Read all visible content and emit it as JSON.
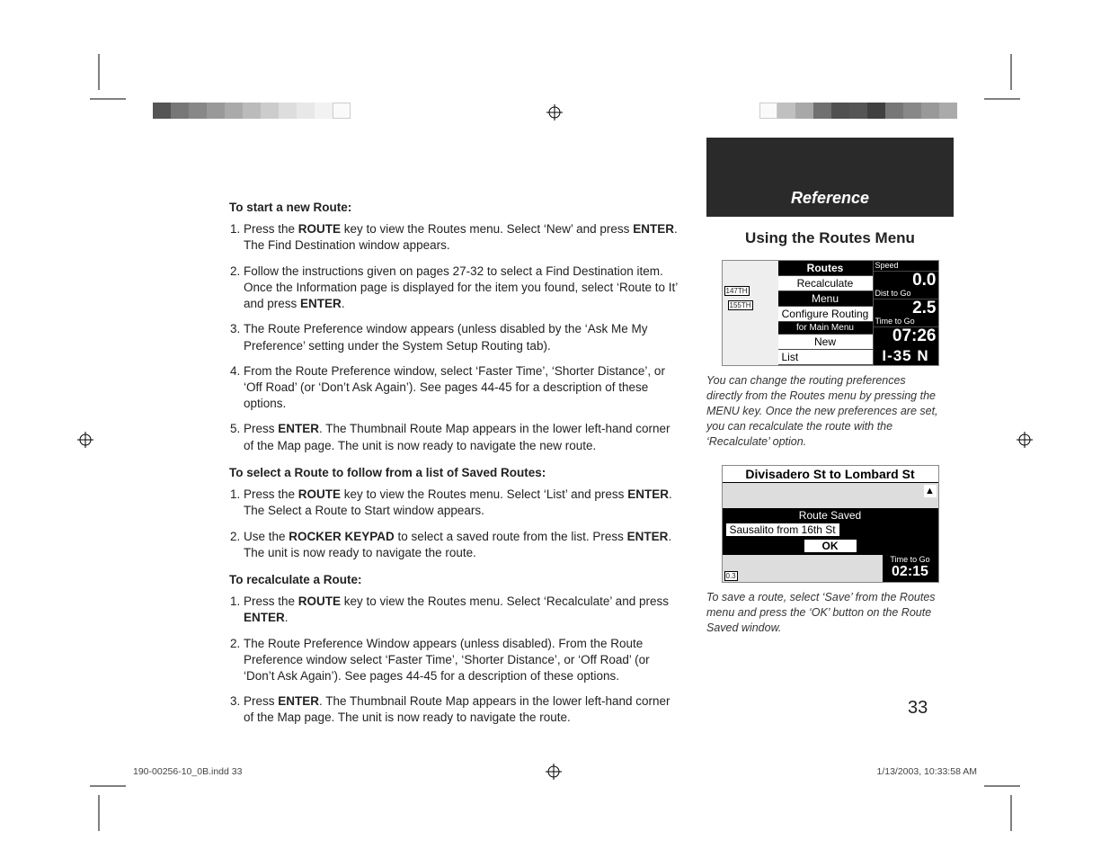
{
  "sidebar": {
    "header": "Reference",
    "subtitle": "Using the Routes Menu",
    "screenshot1": {
      "menu_title": "Routes",
      "item_recalculate": "Recalculate",
      "item_menu": "Menu",
      "item_configure": "Configure Routing",
      "item_mainmenu": "for Main Menu",
      "item_new": "New",
      "item_list": "List",
      "speed_label": "Speed",
      "speed_value": "0.0",
      "dist_label": "Dist to Go",
      "dist_value": "2.5",
      "time_label": "Time to Go",
      "time_value": "07:26",
      "street1": "147TH",
      "street2": "155TH",
      "highway": "I-35 N"
    },
    "caption1": "You can change the routing preferences directly from the Routes menu by pressing the MENU key. Once the new preferences are set, you can recalculate the route with the ‘Recalculate’ option.",
    "screenshot2": {
      "title": "Divisadero St to Lombard St",
      "row_saved": "Route Saved",
      "row_from": "Sausalito from 16th St",
      "ok": "OK",
      "time_label": "Time to Go",
      "time_value": "02:15",
      "dist": "0.3"
    },
    "caption2": "To save a route, select ‘Save’ from the Routes menu and press the ‘OK’ button on the Route Saved window."
  },
  "body": {
    "h1": "To start a new Route:",
    "s1": [
      "Press the <b>ROUTE</b> key to view the Routes menu. Select ‘New’ and press <b>ENTER</b>. The Find Destination window appears.",
      "Follow the instructions given on pages 27-32 to select a Find Destination item. Once the Information page is displayed for the item you found, select ‘Route to It’ and press <b>ENTER</b>.",
      "The Route Preference window appears (unless disabled by the ‘Ask Me My Preference’ setting under the System Setup Routing tab).",
      "From the Route Preference window, select ‘Faster Time’, ‘Shorter Distance’, or ‘Off Road’ (or ‘Don’t Ask Again’). See pages 44-45 for a description of these options.",
      "Press <b>ENTER</b>. The Thumbnail Route Map appears in the lower left-hand corner of the Map page. The unit is now ready to navigate the new route."
    ],
    "h2": "To select a Route to follow from a list of Saved Routes:",
    "s2": [
      "Press the <b>ROUTE</b> key to view the Routes menu. Select ‘List’ and press <b>ENTER</b>. The Select a Route to Start window appears.",
      "Use the <b>ROCKER KEYPAD</b> to select a saved route from the list. Press <b>ENTER</b>. The unit is now ready to navigate the route."
    ],
    "h3": "To recalculate a Route:",
    "s3": [
      "Press the <b>ROUTE</b> key to view the Routes menu. Select ‘Recalculate’ and press <b>ENTER</b>.",
      "The Route Preference Window appears (unless disabled). From the Route Preference window select ‘Faster Time’, ‘Shorter Distance’, or ‘Off Road’ (or ‘Don’t Ask Again’). See pages 44-45 for a description of these options.",
      "Press <b>ENTER</b>. The Thumbnail Route Map appears in the lower left-hand corner of the Map page. The unit is now ready to navigate the route."
    ]
  },
  "page_number": "33",
  "footer": {
    "left": "190-00256-10_0B.indd   33",
    "right": "1/13/2003, 10:33:58 AM"
  }
}
